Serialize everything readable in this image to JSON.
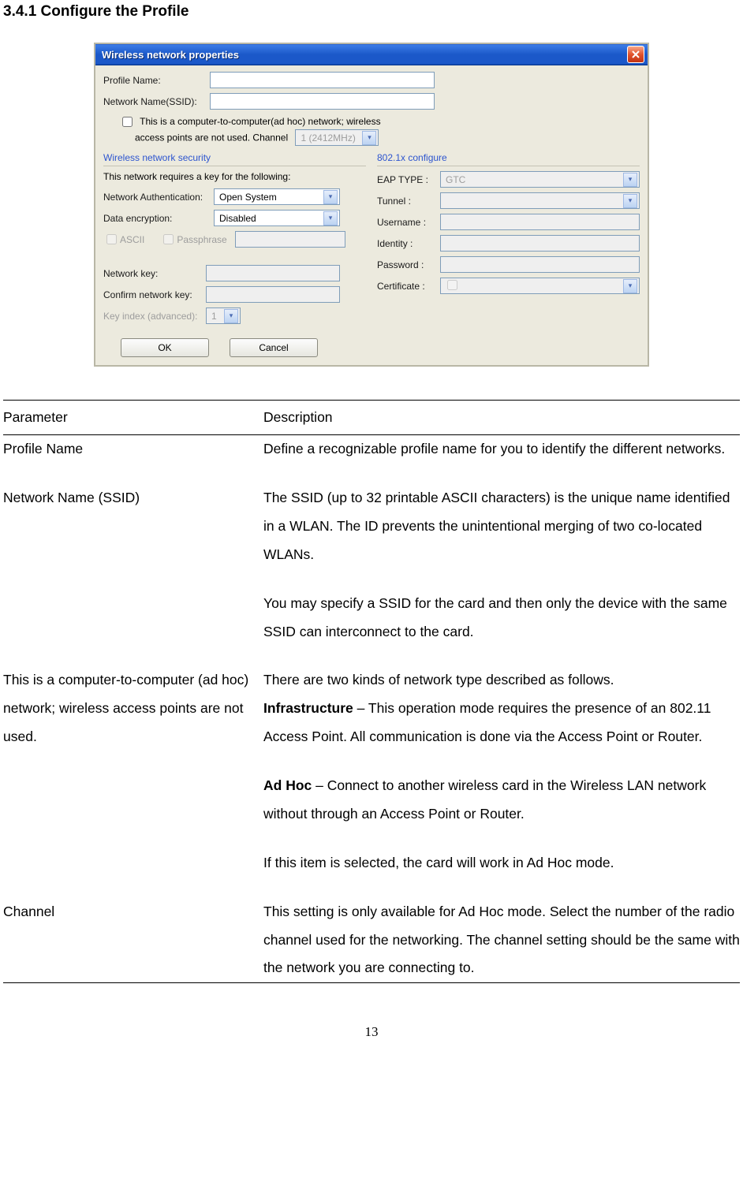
{
  "section_number": "3.4.1",
  "section_title_full": "3.4.1    Configure the Profile",
  "dialog": {
    "title": "Wireless network properties",
    "profile_name_label": "Profile Name:",
    "ssid_label": "Network Name(SSID):",
    "adhoc_line1": "This is a computer-to-computer(ad hoc) network; wireless",
    "adhoc_line2": "access points are not used.        Channel",
    "channel_value": "1 (2412MHz)",
    "security_heading": "Wireless network security",
    "security_desc": "This network requires a key for the following:",
    "net_auth_label": "Network Authentication:",
    "net_auth_value": "Open System",
    "data_enc_label": "Data encryption:",
    "data_enc_value": "Disabled",
    "ascii_label": "ASCII",
    "passphrase_label": "Passphrase",
    "net_key_label": "Network key:",
    "confirm_key_label": "Confirm network key:",
    "key_index_label": "Key index (advanced):",
    "key_index_value": "1",
    "x_heading": "802.1x configure",
    "eap_label": "EAP TYPE :",
    "eap_value": "GTC",
    "tunnel_label": "Tunnel :",
    "username_label": "Username :",
    "identity_label": "Identity :",
    "password_label": "Password :",
    "cert_label": "Certificate :",
    "ok": "OK",
    "cancel": "Cancel"
  },
  "tbl": {
    "h_param": "Parameter",
    "h_desc": "Description",
    "r1p": "Profile Name",
    "r1d": "Define a recognizable profile name for you to identify the different networks.",
    "r2p": "Network Name (SSID)",
    "r2d1": "The SSID (up to 32 printable ASCII characters) is the unique name identified in a WLAN. The ID prevents the unintentional merging of two co-located WLANs.",
    "r2d2": "You may specify a SSID for the card and then only the device with the same SSID can interconnect to the card.",
    "r3p": "This is a computer-to-computer (ad hoc) network; wireless access points are not used.",
    "r3d1a": "There are two kinds of network type described as follows.",
    "r3d1b_bold": "Infrastructure",
    "r3d1b_rest": " – This operation mode requires the presence of an 802.11 Access Point. All communication is done via the Access Point or Router.",
    "r3d2_bold": "Ad Hoc",
    "r3d2_rest": " – Connect to another wireless card in the Wireless LAN network without through an Access Point or Router.",
    "r3d3": "If this item is selected, the card will work in Ad Hoc mode.",
    "r4p": "Channel",
    "r4d": "This setting is only available for Ad Hoc mode. Select the number of the radio channel used for the networking. The channel setting should be the same with the network you are connecting to."
  },
  "page_number": "13"
}
